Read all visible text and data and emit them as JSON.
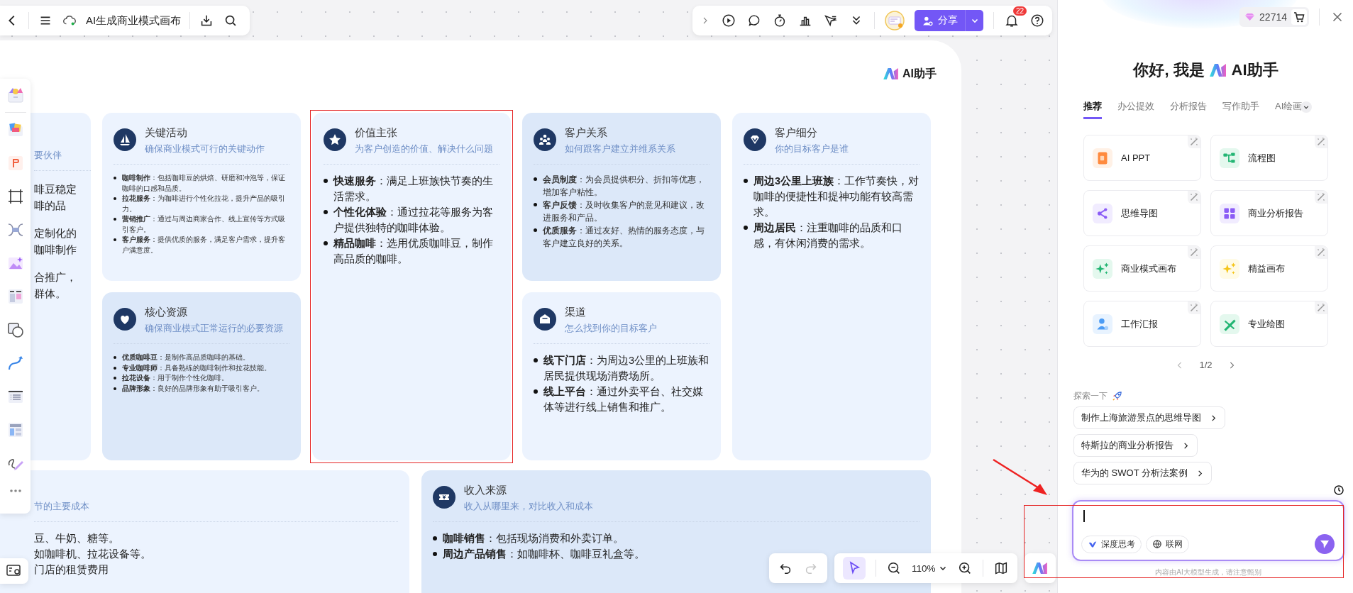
{
  "file_bar": {
    "title": "AI生成商业模式画布"
  },
  "top_toolbar": {
    "share_label": "分享",
    "notification_count": "22"
  },
  "board": {
    "logo_text": "AI助手",
    "partner_card": {
      "subtitle": "要伙伴",
      "item_lines": [
        [
          "啡豆稳定",
          "啡的品"
        ],
        [
          "定制化的",
          "咖啡制作"
        ],
        [
          "合推广，",
          "群体。"
        ]
      ]
    },
    "columns": [
      [
        {
          "title": "关键活动",
          "subtitle": "确保商业模式可行的关键动作",
          "items": [
            "**咖啡制作**：包括咖啡豆的烘焙、研磨和冲泡等，保证咖啡的口感和品质。",
            "**拉花服务**：为咖啡进行个性化拉花，提升产品的吸引力。",
            "**营销推广**：通过与周边商家合作、线上宣传等方式吸引客户。",
            "**客户服务**：提供优质的服务，满足客户需求，提升客户满意度。"
          ]
        },
        {
          "title": "核心资源",
          "subtitle": "确保商业模式正常运行的必要资源",
          "items": [
            "**优质咖啡豆**：是制作高品质咖啡的基础。",
            "**专业咖啡师**：具备熟练的咖啡制作和拉花技能。",
            "**拉花设备**：用于制作个性化咖啡。",
            "**品牌形象**：良好的品牌形象有助于吸引客户。"
          ]
        }
      ],
      [
        {
          "title": "价值主张",
          "subtitle": "为客户创造的价值、解决什么问题",
          "items": [
            "**快速服务**：满足上班族快节奏的生活需求。",
            "**个性化体验**：通过拉花等服务为客户提供独特的咖啡体验。",
            "**精品咖啡**：选用优质咖啡豆，制作高品质的咖啡。"
          ]
        }
      ],
      [
        {
          "title": "客户关系",
          "subtitle": "如何跟客户建立并维系关系",
          "items": [
            "**会员制度**：为会员提供积分、折扣等优惠，增加客户粘性。",
            "**客户反馈**：及时收集客户的意见和建议，改进服务和产品。",
            "**优质服务**：通过友好、热情的服务态度，与客户建立良好的关系。"
          ]
        },
        {
          "title": "渠道",
          "subtitle": "怎么找到你的目标客户",
          "items": [
            "**线下门店**：为周边3公里的上班族和居民提供现场消费场所。",
            "**线上平台**：通过外卖平台、社交媒体等进行线上销售和推广。"
          ]
        }
      ],
      [
        {
          "title": "客户细分",
          "subtitle": "你的目标客户是谁",
          "items": [
            "**周边3公里上班族**：工作节奏快，对咖啡的便捷性和提神功能有较高需求。",
            "**周边居民**：注重咖啡的品质和口感，有休闲消费的需求。"
          ]
        }
      ]
    ],
    "cost_card": {
      "subtitle": "节的主要成本",
      "lines": [
        "豆、牛奶、糖等。",
        "如咖啡机、拉花设备等。",
        "门店的租赁费用"
      ]
    },
    "revenue_card": {
      "title": "收入来源",
      "subtitle": "收入从哪里来，对比收入和成本",
      "items": [
        "**咖啡销售**：包括现场消费和外卖订单。",
        "**周边产品销售**：如咖啡杯、咖啡豆礼盒等。"
      ]
    }
  },
  "bottom_toolbar": {
    "history_buttons": [
      {
        "disabled": false
      },
      {
        "disabled": true
      }
    ],
    "select_tool": {
      "selected": true
    },
    "zoom": "110%"
  },
  "assistant": {
    "credits": "22714",
    "greeting": "你好, 我是",
    "brand": "AI助手",
    "tabs": [
      {
        "label": "推荐",
        "selected": true
      },
      {
        "label": "办公提效",
        "selected": false
      },
      {
        "label": "分析报告",
        "selected": false
      },
      {
        "label": "写作助手",
        "selected": false
      },
      {
        "label": "AI绘画",
        "selected": false
      }
    ],
    "shortcuts": [
      {
        "label": "AI PPT"
      },
      {
        "label": "流程图"
      },
      {
        "label": "思维导图"
      },
      {
        "label": "商业分析报告"
      },
      {
        "label": "商业模式画布"
      },
      {
        "label": "精益画布"
      },
      {
        "label": "工作汇报"
      },
      {
        "label": "专业绘图"
      }
    ],
    "pager": "1/2",
    "explore_label": "探索一下",
    "suggestions": [
      "制作上海旅游景点的思维导图",
      "特斯拉的商业分析报告",
      "华为的 SWOT 分析法案例"
    ],
    "input_chips": [
      "深度思考",
      "联网"
    ],
    "disclaimer": "内容由AI大模型生成，请注意甄别"
  }
}
